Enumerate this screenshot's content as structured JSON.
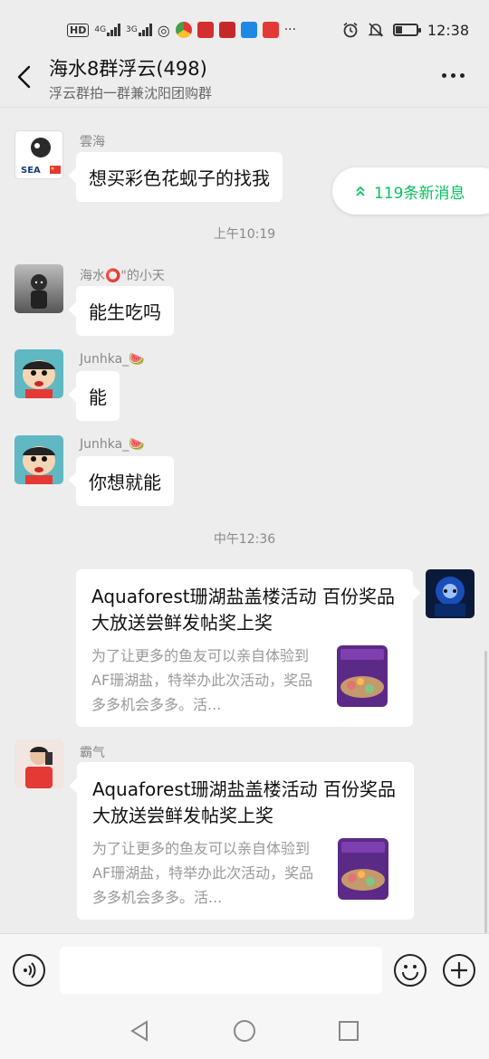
{
  "status_bar": {
    "network_labels": [
      "HD",
      "4G",
      "3G"
    ],
    "time": "12:38"
  },
  "header": {
    "title": "海水8群浮云(498)",
    "subtitle": "浮云群拍一群兼沈阳团购群"
  },
  "new_messages": {
    "label": "119条新消息"
  },
  "messages": [
    {
      "sender": "雲海",
      "text": "想买彩色花蚬子的找我"
    },
    {
      "time": "上午10:19"
    },
    {
      "sender": "海水⭕️\"的小天",
      "text": "能生吃吗"
    },
    {
      "sender": "Junhka_🍉",
      "text": "能"
    },
    {
      "sender": "Junhka_🍉",
      "text": "你想就能"
    },
    {
      "time": "中午12:36"
    },
    {
      "sender": "",
      "card_title": "Aquaforest珊湖盐盖楼活动 百份奖品大放送尝鲜发帖奖上奖",
      "card_desc": "为了让更多的鱼友可以亲自体验到AF珊湖盐，特举办此次活动，奖品多多机会多多。活..."
    },
    {
      "sender": "霸气",
      "card_title": "Aquaforest珊湖盐盖楼活动 百份奖品大放送尝鲜发帖奖上奖",
      "card_desc": "为了让更多的鱼友可以亲自体验到AF珊湖盐，特举办此次活动，奖品多多机会多多。活..."
    }
  ],
  "input": {
    "value": "",
    "placeholder": ""
  },
  "colors": {
    "accent": "#07c160",
    "background": "#ededed",
    "bubble": "#ffffff"
  }
}
